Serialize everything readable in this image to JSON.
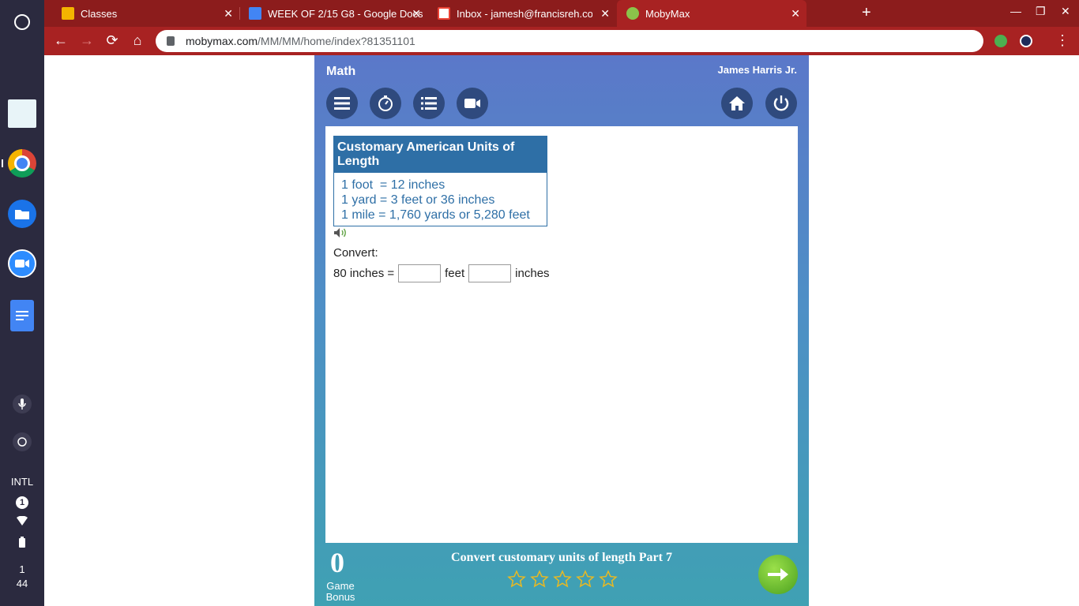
{
  "shelf": {
    "tray": {
      "input_method": "INTL",
      "notification_count": "1",
      "time_hour": "1",
      "time_minute": "44"
    }
  },
  "browser": {
    "tabs": [
      {
        "title": "Classes",
        "favicon": "google-classroom-icon"
      },
      {
        "title": "WEEK OF 2/15 G8 - Google Docs",
        "favicon": "google-docs-icon"
      },
      {
        "title": "Inbox - jamesh@francisreh.com",
        "favicon": "gmail-icon"
      },
      {
        "title": "MobyMax",
        "favicon": "mobymax-icon",
        "active": true
      }
    ],
    "url_host": "mobymax.com",
    "url_path": "/MM/MM/home/index?81351101",
    "colors": {
      "tab_bar": "#8c1c1c",
      "toolbar": "#a82222"
    }
  },
  "app": {
    "subject": "Math",
    "student_name": "James Harris Jr.",
    "reference": {
      "title": "Customary American Units of Length",
      "lines": [
        "1 foot  = 12 inches",
        "1 yard = 3 feet or 36 inches",
        "1 mile = 1,760 yards or 5,280 feet"
      ]
    },
    "question": {
      "prompt": "Convert:",
      "lhs": "80 inches =",
      "unit1": "feet",
      "unit2": "inches",
      "answer_feet": "",
      "answer_inches": ""
    },
    "footer": {
      "game_bonus_value": "0",
      "game_bonus_label_1": "Game",
      "game_bonus_label_2": "Bonus",
      "lesson_title": "Convert customary units of length Part 7",
      "stars_filled": 0,
      "stars_total": 5
    },
    "colors": {
      "accent": "#2e6fa6",
      "button_bg": "#2f4a7e",
      "star": "#e8b923"
    }
  }
}
